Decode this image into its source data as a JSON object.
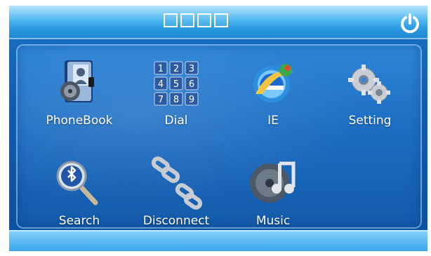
{
  "header": {
    "title": "□□□□",
    "power_icon": "power-icon"
  },
  "menu": {
    "items": [
      {
        "label": "PhoneBook",
        "icon": "phonebook-icon"
      },
      {
        "label": "Dial",
        "icon": "dialpad-icon"
      },
      {
        "label": "IE",
        "icon": "browser-ie-icon"
      },
      {
        "label": "Setting",
        "icon": "gears-icon"
      },
      {
        "label": "Search",
        "icon": "bluetooth-search-icon"
      },
      {
        "label": "Disconnect",
        "icon": "broken-chain-icon"
      },
      {
        "label": "Music",
        "icon": "music-disc-icon"
      }
    ]
  },
  "dialpad": {
    "keys": [
      "1",
      "2",
      "3",
      "4",
      "5",
      "6",
      "7",
      "8",
      "9"
    ]
  },
  "colors": {
    "topbar": "#49b4ee",
    "content": "#1b6bc1",
    "label": "#ffffff"
  }
}
